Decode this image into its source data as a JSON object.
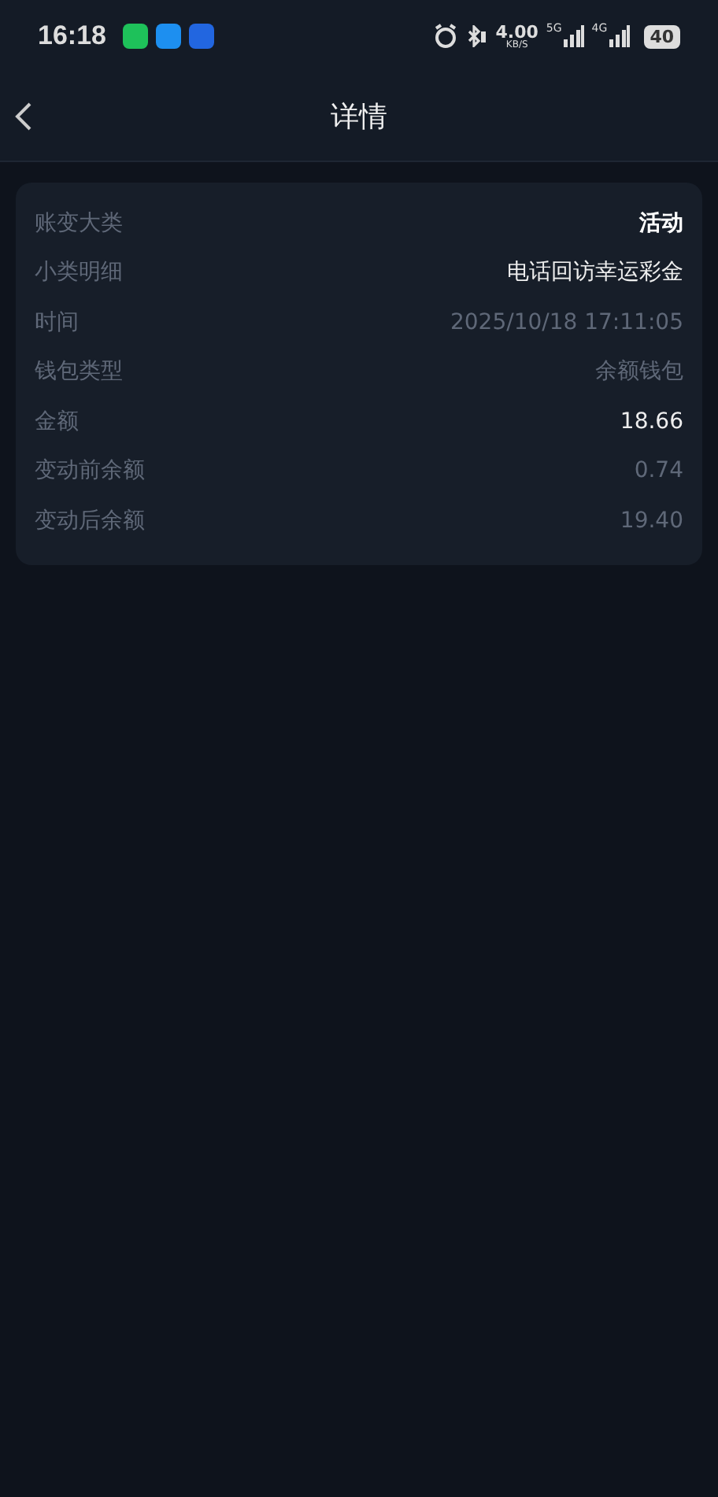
{
  "status_bar": {
    "time": "16:18",
    "net_speed": "4.00",
    "net_unit": "KB/S",
    "network_1": "5G",
    "network_2": "4G",
    "battery": "40"
  },
  "header": {
    "title": "详情"
  },
  "details": [
    {
      "label": "账变大类",
      "value": "活动",
      "kind": "bold"
    },
    {
      "label": "小类明细",
      "value": "电话回访幸运彩金",
      "kind": "bright"
    },
    {
      "label": "时间",
      "value": "2025/10/18 17:11:05",
      "kind": "dim"
    },
    {
      "label": "钱包类型",
      "value": "余额钱包",
      "kind": "dim"
    },
    {
      "label": "金额",
      "value": "18.66",
      "kind": "bright"
    },
    {
      "label": "变动前余额",
      "value": "0.74",
      "kind": "dim"
    },
    {
      "label": "变动后余额",
      "value": "19.40",
      "kind": "dim"
    }
  ]
}
